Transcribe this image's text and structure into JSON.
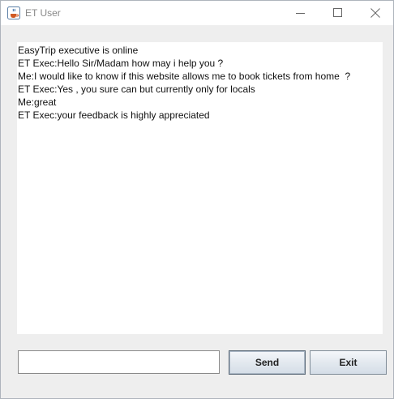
{
  "window": {
    "title": "ET User",
    "icon": "java-cup-icon",
    "controls": [
      "minimize-icon",
      "maximize-icon",
      "close-icon"
    ]
  },
  "chat": {
    "lines": [
      "EasyTrip executive is online",
      "ET Exec:Hello Sir/Madam how may i help you ?",
      "Me:I would like to know if this website allows me to book tickets from home  ?",
      "ET Exec:Yes , you sure can but currently only for locals",
      "Me:great",
      "ET Exec:your feedback is highly appreciated"
    ]
  },
  "input": {
    "value": "",
    "placeholder": ""
  },
  "buttons": {
    "send_label": "Send",
    "exit_label": "Exit"
  }
}
